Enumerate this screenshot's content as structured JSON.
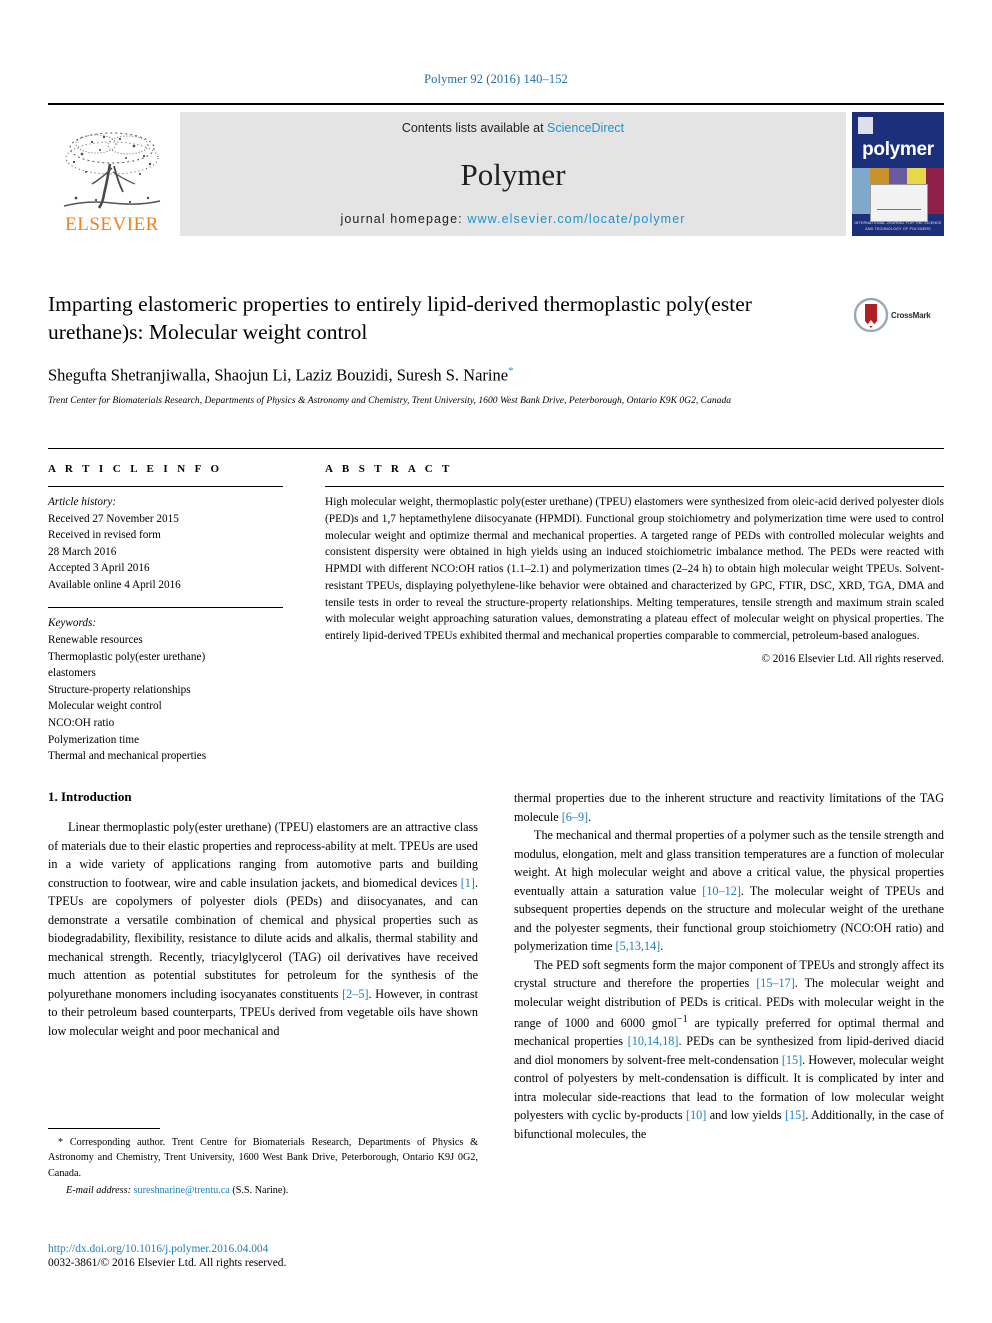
{
  "running_head": "Polymer 92 (2016) 140–152",
  "masthead": {
    "publisher_wordmark": "ELSEVIER",
    "contents_prefix": "Contents lists available at",
    "contents_link": "ScienceDirect",
    "journal_title": "Polymer",
    "homepage_label": "journal homepage:",
    "homepage_url": "www.elsevier.com/locate/polymer",
    "cover_word": "polymer",
    "cover_footer": "INTERNATIONAL JOURNAL FOR THE SCIENCE AND TECHNOLOGY OF POLYMERS"
  },
  "article": {
    "title": "Imparting elastomeric properties to entirely lipid-derived thermoplastic poly(ester urethane)s: Molecular weight control",
    "crossmark_label": "CrossMark",
    "authors": "Shegufta Shetranjiwalla, Shaojun Li, Laziz Bouzidi, Suresh S. Narine",
    "corresponding_marker": "*",
    "affiliation": "Trent Center for Biomaterials Research, Departments of Physics & Astronomy and Chemistry, Trent University, 1600 West Bank Drive, Peterborough, Ontario K9K 0G2, Canada"
  },
  "article_info": {
    "heading": "A R T I C L E   I N F O",
    "history_label": "Article history:",
    "history": [
      "Received 27 November 2015",
      "Received in revised form",
      "28 March 2016",
      "Accepted 3 April 2016",
      "Available online 4 April 2016"
    ],
    "keywords_label": "Keywords:",
    "keywords": [
      "Renewable resources",
      "Thermoplastic poly(ester urethane)",
      "elastomers",
      "Structure-property relationships",
      "Molecular weight control",
      "NCO:OH ratio",
      "Polymerization time",
      "Thermal and mechanical properties"
    ]
  },
  "abstract": {
    "heading": "A B S T R A C T",
    "text": "High molecular weight, thermoplastic poly(ester urethane) (TPEU) elastomers were synthesized from oleic-acid derived polyester diols (PED)s and 1,7 heptamethylene diisocyanate (HPMDI). Functional group stoichiometry and polymerization time were used to control molecular weight and optimize thermal and mechanical properties. A targeted range of PEDs with controlled molecular weights and consistent dispersity were obtained in high yields using an induced stoichiometric imbalance method. The PEDs were reacted with HPMDI with different NCO:OH ratios (1.1–2.1) and polymerization times (2–24 h) to obtain high molecular weight TPEUs. Solvent-resistant TPEUs, displaying polyethylene-like behavior were obtained and characterized by GPC, FTIR, DSC, XRD, TGA, DMA and tensile tests in order to reveal the structure-property relationships. Melting temperatures, tensile strength and maximum strain scaled with molecular weight approaching saturation values, demonstrating a plateau effect of molecular weight on physical properties. The entirely lipid-derived TPEUs exhibited thermal and mechanical properties comparable to commercial, petroleum-based analogues.",
    "copyright": "© 2016 Elsevier Ltd. All rights reserved."
  },
  "introduction": {
    "section_number": "1.",
    "section_title": "Introduction",
    "left_para_1_a": "Linear thermoplastic poly(ester urethane) (TPEU) elastomers are an attractive class of materials due to their elastic properties and reprocess-ability at melt. TPEUs are used in a wide variety of applications ranging from automotive parts and building construction to footwear, wire and cable insulation jackets, and biomedical devices ",
    "ref_1": "[1]",
    "left_para_1_b": ". TPEUs are copolymers of polyester diols (PEDs) and diisocyanates, and can demonstrate a versatile combination of chemical and physical properties such as biodegradability, flexibility, resistance to dilute acids and alkalis, thermal stability and mechanical strength. Recently, triacylglycerol (TAG) oil derivatives have received much attention as potential substitutes for petroleum for the synthesis of the polyurethane monomers including isocyanates constituents ",
    "ref_2_5": "[2–5]",
    "left_para_1_c": ". However, in contrast to their petroleum based counterparts, TPEUs derived from vegetable oils have shown low molecular weight and poor mechanical and",
    "right_para_1_a": "thermal properties due to the inherent structure and reactivity limitations of the TAG molecule ",
    "ref_6_9": "[6–9]",
    "right_para_1_b": ".",
    "right_para_2_a": "The mechanical and thermal properties of a polymer such as the tensile strength and modulus, elongation, melt and glass transition temperatures are a function of molecular weight. At high molecular weight and above a critical value, the physical properties eventually attain a saturation value ",
    "ref_10_12": "[10–12]",
    "right_para_2_b": ". The molecular weight of TPEUs and subsequent properties depends on the structure and molecular weight of the urethane and the polyester segments, their functional group stoichiometry (NCO:OH ratio) and polymerization time ",
    "ref_5_13_14": "[5,13,14]",
    "right_para_2_c": ".",
    "right_para_3_a": "The PED soft segments form the major component of TPEUs and strongly affect its crystal structure and therefore the properties ",
    "ref_15_17": "[15–17]",
    "right_para_3_b": ". The molecular weight and molecular weight distribution of PEDs is critical. PEDs with molecular weight in the range of 1000 and 6000 gmol",
    "superscript_minus1": "−1",
    "right_para_3_c": " are typically preferred for optimal thermal and mechanical properties ",
    "ref_10_14_18": "[10,14,18]",
    "right_para_3_d": ". PEDs can be synthesized from lipid-derived diacid and diol monomers by solvent-free melt-condensation ",
    "ref_15": "[15]",
    "right_para_3_e": ". However, molecular weight control of polyesters by melt-condensation is difficult. It is complicated by inter and intra molecular side-reactions that lead to the formation of low molecular weight polyesters with cyclic by-products ",
    "ref_10": "[10]",
    "right_para_3_f": " and low yields ",
    "ref_15_b": "[15]",
    "right_para_3_g": ". Additionally, in the case of bifunctional molecules, the"
  },
  "footnote": {
    "marker": "*",
    "text": " Corresponding author. Trent Centre for Biomaterials Research, Departments of Physics & Astronomy and Chemistry, Trent University, 1600 West Bank Drive, Peterborough, Ontario K9J 0G2, Canada.",
    "email_label": "E-mail address:",
    "email": "sureshnarine@trentu.ca",
    "email_suffix": "(S.S. Narine)."
  },
  "footer": {
    "doi": "http://dx.doi.org/10.1016/j.polymer.2016.04.004",
    "issn_line": "0032-3861/© 2016 Elsevier Ltd. All rights reserved."
  },
  "colors": {
    "link_blue": "#1d7fb8",
    "sciencedirect_blue": "#2092cf",
    "elsevier_orange": "#f08122",
    "cover_navy": "#1b2f7a"
  }
}
